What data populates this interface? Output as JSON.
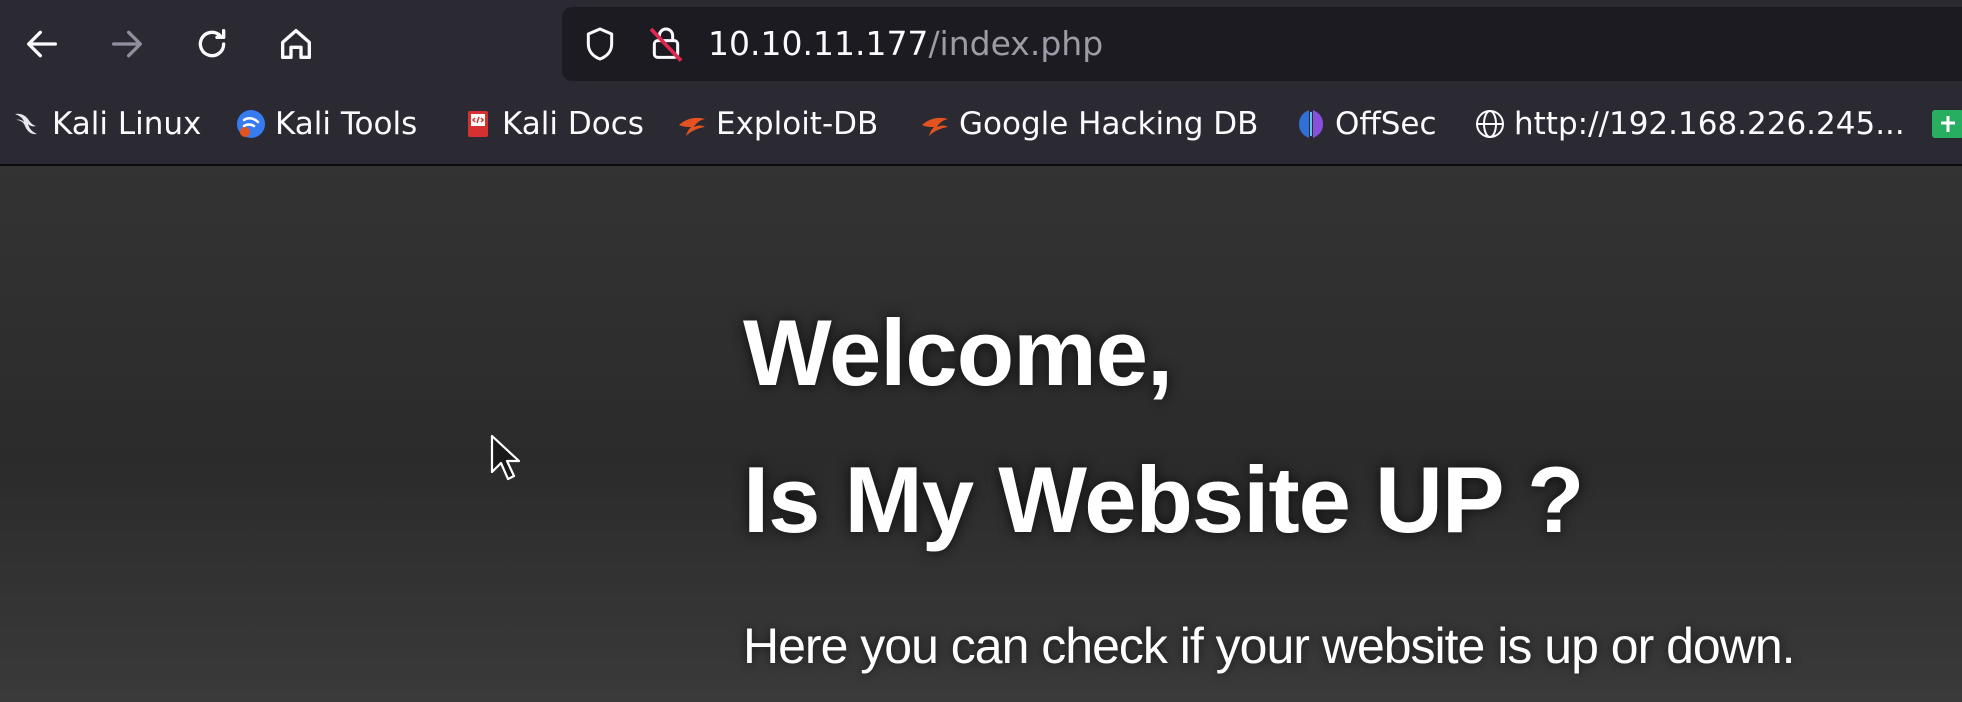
{
  "toolbar": {
    "url_host": "10.10.11.177",
    "url_path": "/index.php"
  },
  "bookmarks": [
    {
      "label": "Kali Linux",
      "icon": "kali-dragon-icon"
    },
    {
      "label": "Kali Tools",
      "icon": "kali-tools-icon"
    },
    {
      "label": "Kali Docs",
      "icon": "kali-docs-icon"
    },
    {
      "label": "Exploit-DB",
      "icon": "exploit-db-icon"
    },
    {
      "label": "Google Hacking DB",
      "icon": "ghdb-icon"
    },
    {
      "label": "OffSec",
      "icon": "offsec-icon"
    },
    {
      "label": "http://192.168.226.245...",
      "icon": "globe-icon"
    }
  ],
  "page": {
    "heading_line1": "Welcome,",
    "heading_line2": "Is My Website UP ?",
    "subtitle": "Here you can check if your website is up or down."
  },
  "colors": {
    "toolbar_bg": "#2b2a33",
    "url_bar_bg": "#1c1b22",
    "url_host": "#fbfbfe",
    "url_path": "#9d9ca6",
    "exploit_orange": "#e2531f",
    "page_bg": "#303030",
    "heading": "#ffffff"
  }
}
